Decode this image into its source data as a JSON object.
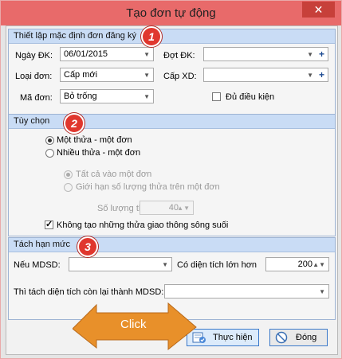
{
  "window": {
    "title": "Tạo đơn tự động",
    "close_glyph": "✕"
  },
  "group1": {
    "header": "Thiết lập mặc định đơn đăng ký",
    "ngay_dk": {
      "label": "Ngày ĐK:",
      "value": "06/01/2015"
    },
    "dot_dk": {
      "label": "Đợt ĐK:",
      "value": ""
    },
    "loai_don": {
      "label": "Loại đơn:",
      "value": "Cấp mới"
    },
    "cap_xd": {
      "label": "Cấp XD:",
      "value": ""
    },
    "ma_don": {
      "label": "Mã đơn:",
      "value": "Bỏ trống"
    },
    "du_dieu_kien": {
      "label": "Đủ điều kiện",
      "checked": false
    }
  },
  "group2": {
    "header": "Tùy chọn",
    "mot_thua": {
      "label": "Một thửa - một đơn",
      "selected": true
    },
    "nhieu_thua": {
      "label": "Nhiều thửa - một đơn",
      "selected": false
    },
    "tat_ca": {
      "label": "Tất cả vào một đơn",
      "selected": true
    },
    "gioi_han": {
      "label": "Giới hạn số lượng thửa trên một đơn",
      "selected": false
    },
    "so_luong": {
      "label": "Số lượng thửa:",
      "value": "40"
    },
    "khong_tao": {
      "label": "Không tạo những thửa giao thông sông suối",
      "checked": true
    }
  },
  "group3": {
    "header": "Tách hạn mức",
    "neu_mdsd": {
      "label": "Nếu MDSD:",
      "value": ""
    },
    "co_dien_tich": {
      "label": "Có diện tích lớn hơn",
      "value": "200"
    },
    "thi_tach": {
      "label": "Thì tách diện tích còn lại thành MDSD:",
      "value": ""
    }
  },
  "badges": [
    "1",
    "2",
    "3"
  ],
  "annotation": {
    "click_label": "Click"
  },
  "buttons": {
    "thuc_hien": "Thực hiện",
    "dong": "Đóng"
  },
  "colors": {
    "titlebar": "#e86a6a",
    "close": "#c7403a",
    "group_header": "#c9dcf5",
    "arrow": "#e8902a",
    "badge": "#e0372e"
  },
  "icons": [
    "close-icon",
    "dropdown-arrow-icon",
    "add-plus-icon",
    "execute-icon",
    "cancel-icon",
    "click-arrow"
  ]
}
